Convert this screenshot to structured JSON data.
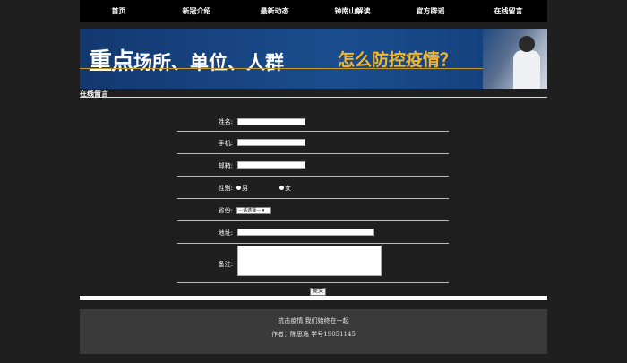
{
  "nav": {
    "items": [
      {
        "label": "首页"
      },
      {
        "label": "新冠介绍"
      },
      {
        "label": "最新动态"
      },
      {
        "label": "钟南山解读"
      },
      {
        "label": "官方辟谣"
      },
      {
        "label": "在线留言"
      }
    ]
  },
  "banner": {
    "headline_part1": "重点",
    "headline_part2": "场所、单位、人群",
    "tagline": "怎么防控疫情？"
  },
  "section": {
    "title": "在线留言"
  },
  "form": {
    "name_label": "姓名:",
    "phone_label": "手机:",
    "email_label": "邮箱:",
    "gender_label": "性别:",
    "gender_male": "男",
    "gender_female": "女",
    "province_label": "省份:",
    "province_selected": "---请选择---",
    "address_label": "地址:",
    "remark_label": "备注:",
    "submit_label": "提交"
  },
  "footer": {
    "line1": "抗击疫情  我们始终在一起",
    "line2": "作者：陈思逸  学号19051145"
  }
}
